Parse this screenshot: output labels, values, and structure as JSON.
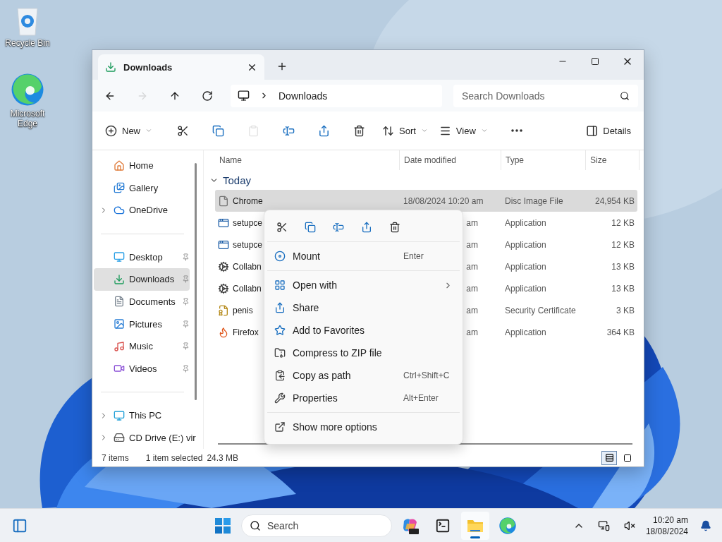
{
  "desktop_icons": [
    {
      "label": "Recycle Bin",
      "kind": "recycle"
    },
    {
      "label": "Microsoft Edge",
      "kind": "edge"
    }
  ],
  "window": {
    "tabs": [
      {
        "label": "Downloads",
        "selected": true
      }
    ],
    "nav": [
      {
        "kind": "back",
        "disabled": false
      },
      {
        "kind": "forward",
        "disabled": true
      },
      {
        "kind": "up",
        "disabled": false
      },
      {
        "kind": "refresh",
        "disabled": false
      }
    ],
    "address": {
      "path": "Downloads"
    },
    "search": {
      "placeholder": "Search Downloads"
    },
    "toolbar": [
      {
        "kind": "new",
        "label": "New",
        "dropdown": true,
        "disabled": false
      },
      {
        "kind": "cut",
        "dropdown": false,
        "disabled": false
      },
      {
        "kind": "copy",
        "dropdown": false,
        "disabled": false
      },
      {
        "kind": "paste",
        "dropdown": false,
        "disabled": true
      },
      {
        "kind": "rename",
        "dropdown": false,
        "disabled": false
      },
      {
        "kind": "share",
        "dropdown": false,
        "disabled": false
      },
      {
        "kind": "delete",
        "dropdown": false,
        "disabled": false
      },
      {
        "kind": "sort",
        "label": "Sort",
        "dropdown": true,
        "disabled": false
      },
      {
        "kind": "view",
        "label": "View",
        "dropdown": true,
        "disabled": false
      },
      {
        "kind": "more",
        "dropdown": false,
        "disabled": false
      }
    ],
    "details_button": {
      "label": "Details"
    },
    "sidebar": [
      [
        {
          "label": "Home",
          "kind": "home",
          "expandable": false,
          "pinned": false,
          "selected": false
        },
        {
          "label": "Gallery",
          "kind": "gallery",
          "expandable": false,
          "pinned": false,
          "selected": false
        },
        {
          "label": "OneDrive",
          "kind": "cloud",
          "expandable": true,
          "pinned": false,
          "selected": false
        }
      ],
      [
        {
          "label": "Desktop",
          "kind": "desktop",
          "expandable": false,
          "pinned": true,
          "selected": false
        },
        {
          "label": "Downloads",
          "kind": "download",
          "expandable": false,
          "pinned": true,
          "selected": true
        },
        {
          "label": "Documents",
          "kind": "document",
          "expandable": false,
          "pinned": true,
          "selected": false
        },
        {
          "label": "Pictures",
          "kind": "picture",
          "expandable": false,
          "pinned": true,
          "selected": false
        },
        {
          "label": "Music",
          "kind": "music",
          "expandable": false,
          "pinned": true,
          "selected": false
        },
        {
          "label": "Videos",
          "kind": "video",
          "expandable": false,
          "pinned": true,
          "selected": false
        }
      ],
      [
        {
          "label": "This PC",
          "kind": "pc",
          "expandable": true,
          "pinned": false,
          "selected": false
        },
        {
          "label": "CD Drive (E:) vir",
          "kind": "drive",
          "expandable": true,
          "pinned": false,
          "selected": false
        }
      ]
    ],
    "columns": [
      "Name",
      "Date modified",
      "Type",
      "Size"
    ],
    "group": {
      "label": "Today",
      "expanded": true
    },
    "rows": [
      {
        "name": "Chrome",
        "date": "18/08/2024 10:20 am",
        "type": "Disc Image File",
        "size": "24,954 KB",
        "kind": "iso",
        "selected": true
      },
      {
        "name": "setupce",
        "date": "am",
        "type": "Application",
        "size": "12 KB",
        "kind": "app",
        "selected": false
      },
      {
        "name": "setupce",
        "date": "am",
        "type": "Application",
        "size": "12 KB",
        "kind": "app",
        "selected": false
      },
      {
        "name": "Collabn",
        "date": "am",
        "type": "Application",
        "size": "13 KB",
        "kind": "tool",
        "selected": false
      },
      {
        "name": "Collabn",
        "date": "am",
        "type": "Application",
        "size": "13 KB",
        "kind": "tool",
        "selected": false
      },
      {
        "name": "penis",
        "date": "am",
        "type": "Security Certificate",
        "size": "3 KB",
        "kind": "cert",
        "selected": false
      },
      {
        "name": "Firefox",
        "date": "am",
        "type": "Application",
        "size": "364 KB",
        "kind": "installer",
        "selected": false
      }
    ],
    "context_menu": {
      "actions": [
        {
          "kind": "cut"
        },
        {
          "kind": "copy"
        },
        {
          "kind": "rename"
        },
        {
          "kind": "share"
        },
        {
          "kind": "delete"
        }
      ],
      "sections": [
        [
          {
            "label": "Mount",
            "shortcut": "Enter",
            "kind": "mount",
            "submenu": false
          }
        ],
        [
          {
            "label": "Open with",
            "kind": "open",
            "submenu": true
          },
          {
            "label": "Share",
            "kind": "share",
            "submenu": false
          },
          {
            "label": "Add to Favorites",
            "kind": "favorite",
            "submenu": false
          },
          {
            "label": "Compress to ZIP file",
            "kind": "zip",
            "submenu": false
          },
          {
            "label": "Copy as path",
            "shortcut": "Ctrl+Shift+C",
            "kind": "path",
            "submenu": false
          },
          {
            "label": "Properties",
            "shortcut": "Alt+Enter",
            "kind": "properties",
            "submenu": false
          }
        ],
        [
          {
            "label": "Show more options",
            "kind": "more",
            "submenu": false
          }
        ]
      ]
    },
    "status_bar": {
      "count": "7 items",
      "selection": "1 item selected",
      "size": "24.3 MB"
    },
    "views": [
      {
        "kind": "details",
        "selected": true
      },
      {
        "kind": "tiles",
        "selected": false
      }
    ]
  },
  "taskbar": {
    "search": {
      "placeholder": "Search"
    },
    "apps": [
      {
        "kind": "copilot",
        "active": false
      },
      {
        "kind": "terminal",
        "active": false
      },
      {
        "kind": "explorer",
        "active": true
      },
      {
        "kind": "edge",
        "active": false
      }
    ],
    "tray": [
      {
        "kind": "chevron"
      },
      {
        "kind": "network"
      },
      {
        "kind": "sound"
      }
    ],
    "clock": {
      "time": "10:20 am",
      "date": "18/08/2024"
    }
  }
}
